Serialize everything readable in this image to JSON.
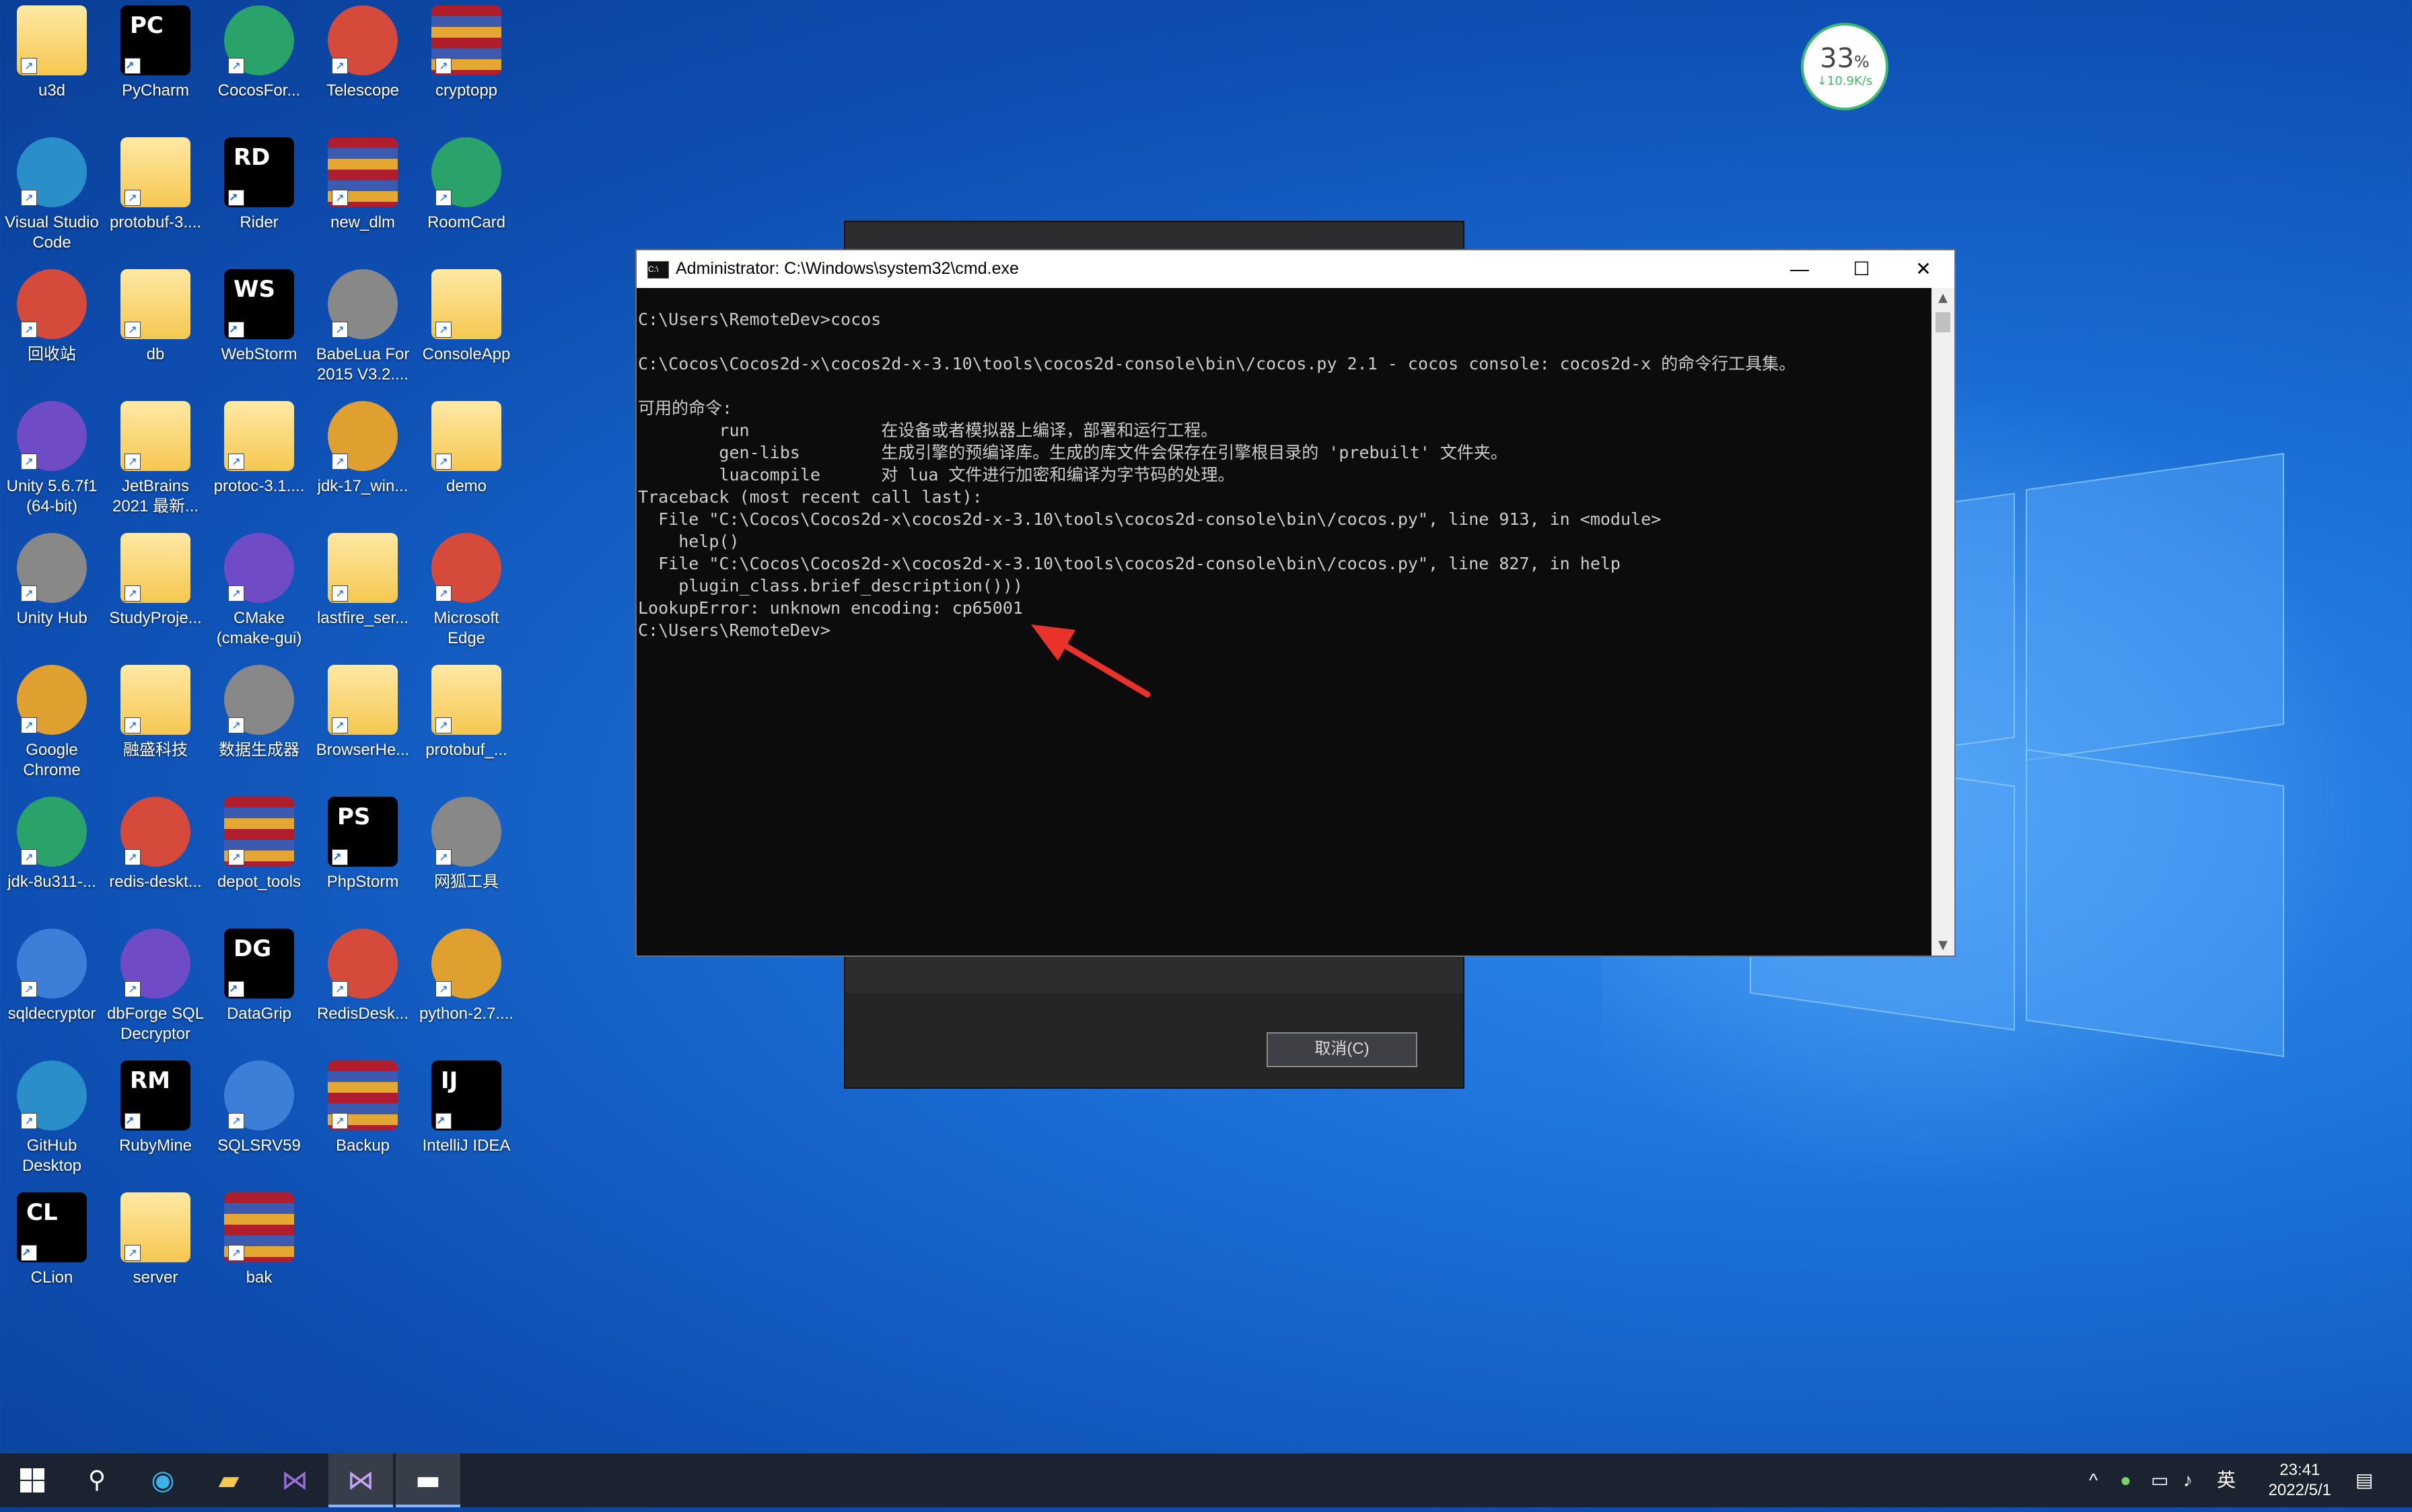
{
  "desktop_icons": [
    {
      "label": "u3d",
      "kind": "folder"
    },
    {
      "label": "PyCharm",
      "kind": "jb",
      "abbr": "PC"
    },
    {
      "label": "CocosFor...",
      "kind": "app"
    },
    {
      "label": "Telescope",
      "kind": "app"
    },
    {
      "label": "cryptopp",
      "kind": "rar"
    },
    {
      "label": "Visual Studio Code",
      "kind": "app"
    },
    {
      "label": "protobuf-3....",
      "kind": "folder"
    },
    {
      "label": "Rider",
      "kind": "jb",
      "abbr": "RD"
    },
    {
      "label": "new_dlm",
      "kind": "rar"
    },
    {
      "label": "RoomCard",
      "kind": "app"
    },
    {
      "label": "回收站",
      "kind": "app"
    },
    {
      "label": "db",
      "kind": "folder"
    },
    {
      "label": "WebStorm",
      "kind": "jb",
      "abbr": "WS"
    },
    {
      "label": "BabeLua For 2015 V3.2....",
      "kind": "app"
    },
    {
      "label": "ConsoleApp",
      "kind": "folder"
    },
    {
      "label": "Unity 5.6.7f1 (64-bit)",
      "kind": "app"
    },
    {
      "label": "JetBrains 2021 最新...",
      "kind": "folder"
    },
    {
      "label": "protoc-3.1....",
      "kind": "folder"
    },
    {
      "label": "jdk-17_win...",
      "kind": "app"
    },
    {
      "label": "demo",
      "kind": "folder"
    },
    {
      "label": "Unity Hub",
      "kind": "app"
    },
    {
      "label": "StudyProje...",
      "kind": "folder"
    },
    {
      "label": "CMake (cmake-gui)",
      "kind": "app"
    },
    {
      "label": "lastfire_ser...",
      "kind": "folder"
    },
    {
      "label": "Microsoft Edge",
      "kind": "app"
    },
    {
      "label": "Google Chrome",
      "kind": "app"
    },
    {
      "label": "融盛科技",
      "kind": "folder"
    },
    {
      "label": "数据生成器",
      "kind": "app"
    },
    {
      "label": "BrowserHe...",
      "kind": "folder"
    },
    {
      "label": "protobuf_...",
      "kind": "folder"
    },
    {
      "label": "jdk-8u311-...",
      "kind": "app"
    },
    {
      "label": "redis-deskt...",
      "kind": "app"
    },
    {
      "label": "depot_tools",
      "kind": "rar"
    },
    {
      "label": "PhpStorm",
      "kind": "jb",
      "abbr": "PS"
    },
    {
      "label": "网狐工具",
      "kind": "app"
    },
    {
      "label": "sqldecryptor",
      "kind": "app"
    },
    {
      "label": "dbForge SQL Decryptor",
      "kind": "app"
    },
    {
      "label": "DataGrip",
      "kind": "jb",
      "abbr": "DG"
    },
    {
      "label": "RedisDesk...",
      "kind": "app"
    },
    {
      "label": "python-2.7....",
      "kind": "app"
    },
    {
      "label": "GitHub Desktop",
      "kind": "app"
    },
    {
      "label": "RubyMine",
      "kind": "jb",
      "abbr": "RM"
    },
    {
      "label": "SQLSRV59",
      "kind": "app"
    },
    {
      "label": "Backup",
      "kind": "rar"
    },
    {
      "label": "IntelliJ IDEA",
      "kind": "jb",
      "abbr": "IJ"
    },
    {
      "label": "CLion",
      "kind": "jb",
      "abbr": "CL"
    },
    {
      "label": "server",
      "kind": "folder"
    },
    {
      "label": "bak",
      "kind": "rar"
    }
  ],
  "background_window": {
    "cancel_label": "取消(C)"
  },
  "cmd": {
    "title": "Administrator: C:\\Windows\\system32\\cmd.exe",
    "lines": [
      "C:\\Users\\RemoteDev>cocos",
      "",
      "C:\\Cocos\\Cocos2d-x\\cocos2d-x-3.10\\tools\\cocos2d-console\\bin\\/cocos.py 2.1 - cocos console: cocos2d-x 的命令行工具集。",
      "",
      "可用的命令:",
      "        run             在设备或者模拟器上编译，部署和运行工程。",
      "        gen-libs        生成引擎的预编译库。生成的库文件会保存在引擎根目录的 'prebuilt' 文件夹。",
      "        luacompile      对 lua 文件进行加密和编译为字节码的处理。",
      "Traceback (most recent call last):",
      "  File \"C:\\Cocos\\Cocos2d-x\\cocos2d-x-3.10\\tools\\cocos2d-console\\bin\\/cocos.py\", line 913, in <module>",
      "    help()",
      "  File \"C:\\Cocos\\Cocos2d-x\\cocos2d-x-3.10\\tools\\cocos2d-console\\bin\\/cocos.py\", line 827, in help",
      "    plugin_class.brief_description()))",
      "LookupError: unknown encoding: cp65001",
      "C:\\Users\\RemoteDev>"
    ]
  },
  "net_widget": {
    "percent": "33",
    "unit": "%",
    "speed": "↓10.9K/s"
  },
  "taskbar": {
    "clock_time": "23:41",
    "clock_date": "2022/5/1",
    "ime": "英"
  },
  "colors": {
    "accent": "#3fba6d",
    "arrow": "#e8322a",
    "cmd_bg": "#0c0c0c"
  }
}
